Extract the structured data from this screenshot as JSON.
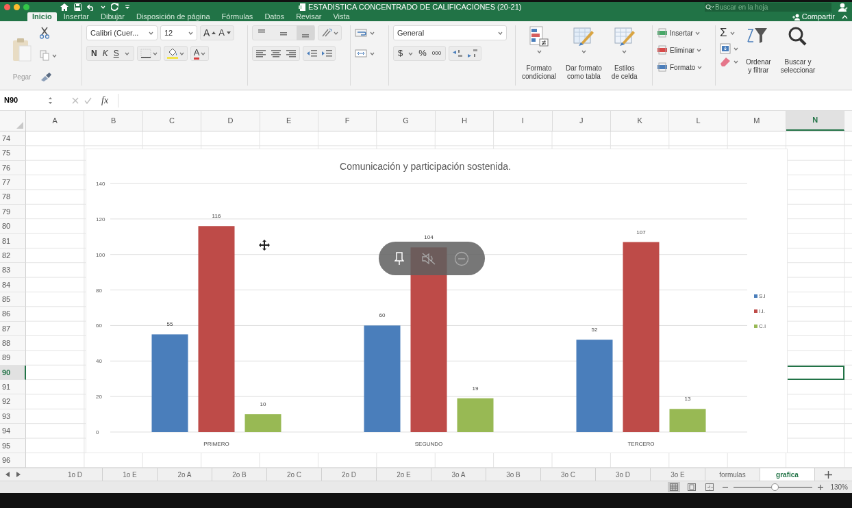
{
  "window": {
    "title": "ESTADISTICA CONCENTRADO DE CALIFICACIONES (20-21)",
    "search": {
      "placeholder": "Buscar en la hoja"
    }
  },
  "ribbon_tabs": [
    {
      "label": "Inicio",
      "selected": true
    },
    {
      "label": "Insertar",
      "selected": false
    },
    {
      "label": "Dibujar",
      "selected": false
    },
    {
      "label": "Disposición de página",
      "selected": false
    },
    {
      "label": "Fórmulas",
      "selected": false
    },
    {
      "label": "Datos",
      "selected": false
    },
    {
      "label": "Revisar",
      "selected": false
    },
    {
      "label": "Vista",
      "selected": false
    }
  ],
  "share_button": "Compartir",
  "clipboard": {
    "paste": "Pegar",
    "paste_disabled": true
  },
  "font": {
    "name": "Calibri (Cuer...",
    "size": "12",
    "grow": "A",
    "shrink": "A",
    "bold": "N",
    "italic": "K",
    "underline": "S",
    "font_color_button": "A"
  },
  "number": {
    "format": "General",
    "currency": "$",
    "percent": "%",
    "thousands": "000"
  },
  "styles": [
    {
      "lines": [
        "Formato",
        "condicional"
      ]
    },
    {
      "lines": [
        "Dar formato",
        "como tabla"
      ]
    },
    {
      "lines": [
        "Estilos",
        "de celda"
      ]
    }
  ],
  "cells": [
    "Insertar",
    "Eliminar",
    "Formato"
  ],
  "editing": {
    "sum": "Σ",
    "sort": [
      "Ordenar",
      "y filtrar"
    ],
    "find": [
      "Buscar y",
      "seleccionar"
    ]
  },
  "formula_bar": {
    "name_box": "N90",
    "function": "fx"
  },
  "columns": [
    {
      "label": "A",
      "selected": false
    },
    {
      "label": "B",
      "selected": false
    },
    {
      "label": "C",
      "selected": false
    },
    {
      "label": "D",
      "selected": false
    },
    {
      "label": "E",
      "selected": false
    },
    {
      "label": "F",
      "selected": false
    },
    {
      "label": "G",
      "selected": false
    },
    {
      "label": "H",
      "selected": false
    },
    {
      "label": "I",
      "selected": false
    },
    {
      "label": "J",
      "selected": false
    },
    {
      "label": "K",
      "selected": false
    },
    {
      "label": "L",
      "selected": false
    },
    {
      "label": "M",
      "selected": false
    },
    {
      "label": "N",
      "selected": true
    }
  ],
  "rows": [
    {
      "label": "74",
      "selected": false
    },
    {
      "label": "75",
      "selected": false
    },
    {
      "label": "76",
      "selected": false
    },
    {
      "label": "77",
      "selected": false
    },
    {
      "label": "78",
      "selected": false
    },
    {
      "label": "79",
      "selected": false
    },
    {
      "label": "80",
      "selected": false
    },
    {
      "label": "81",
      "selected": false
    },
    {
      "label": "82",
      "selected": false
    },
    {
      "label": "83",
      "selected": false
    },
    {
      "label": "84",
      "selected": false
    },
    {
      "label": "85",
      "selected": false
    },
    {
      "label": "86",
      "selected": false
    },
    {
      "label": "87",
      "selected": false
    },
    {
      "label": "88",
      "selected": false
    },
    {
      "label": "89",
      "selected": false
    },
    {
      "label": "90",
      "selected": true
    },
    {
      "label": "91",
      "selected": false
    },
    {
      "label": "92",
      "selected": false
    },
    {
      "label": "93",
      "selected": false
    },
    {
      "label": "94",
      "selected": false
    },
    {
      "label": "95",
      "selected": false
    },
    {
      "label": "96",
      "selected": false
    }
  ],
  "chart": {
    "chart_data": {
      "type": "bar",
      "title": "Comunicación y participación sostenida.",
      "categories": [
        "PRIMERO",
        "SEGUNDO",
        "TERCERO"
      ],
      "series": [
        {
          "name": "S.I",
          "color": "#4a7ebb",
          "values": [
            55,
            60,
            52
          ]
        },
        {
          "name": "I.I.",
          "color": "#be4b48",
          "values": [
            116,
            104,
            107
          ]
        },
        {
          "name": "C.I",
          "color": "#98b954",
          "values": [
            10,
            19,
            13
          ]
        }
      ],
      "ylim": [
        0,
        140
      ],
      "yticks": [
        0,
        20,
        40,
        60,
        80,
        100,
        120,
        140
      ],
      "data_labels": true,
      "grid": true,
      "legend": true
    }
  },
  "sheet_tabs": [
    {
      "label": "1o D",
      "selected": false
    },
    {
      "label": "1o E",
      "selected": false
    },
    {
      "label": "2o A",
      "selected": false
    },
    {
      "label": "2o B",
      "selected": false
    },
    {
      "label": "2o C",
      "selected": false
    },
    {
      "label": "2o D",
      "selected": false
    },
    {
      "label": "2o E",
      "selected": false
    },
    {
      "label": "3o A",
      "selected": false
    },
    {
      "label": "3o B",
      "selected": false
    },
    {
      "label": "3o C",
      "selected": false
    },
    {
      "label": "3o D",
      "selected": false
    },
    {
      "label": "3o E",
      "selected": false
    },
    {
      "label": "formulas",
      "selected": false
    },
    {
      "label": "grafica",
      "selected": true
    }
  ],
  "status_bar": {
    "views": [
      {
        "selected": true
      },
      {
        "selected": false
      },
      {
        "selected": false
      }
    ],
    "zoom": "130%",
    "zoom_slider": {
      "level": 0.52
    }
  }
}
